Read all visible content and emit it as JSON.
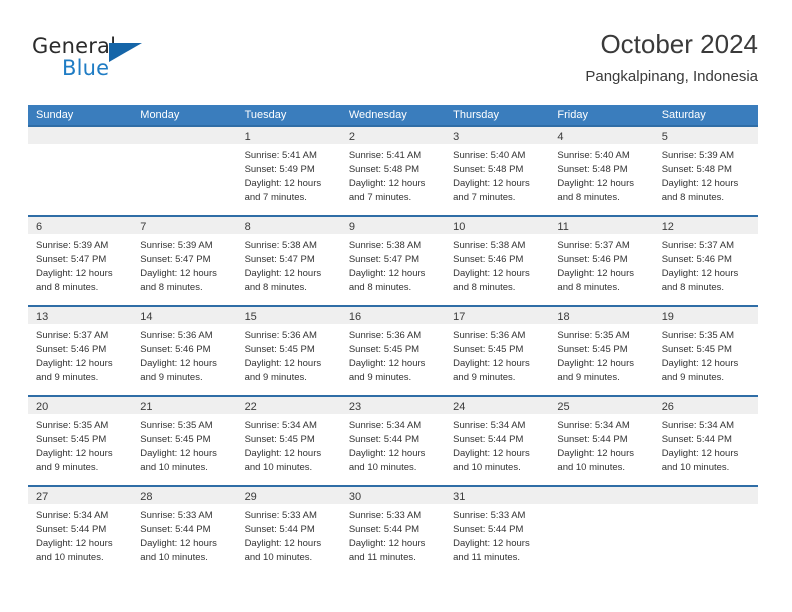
{
  "brand": {
    "name_top": "General",
    "name_bottom": "Blue",
    "triangle_icon": "triangle-icon",
    "color_dark": "#2b2b2b",
    "color_blue": "#1f7cc4"
  },
  "header": {
    "title": "October 2024",
    "subtitle": "Pangkalpinang, Indonesia"
  },
  "theme": {
    "header_bar": "#3a7dbd",
    "cell_top_border": "#2f6da6",
    "daynum_bg": "#efefef"
  },
  "weekdays": [
    "Sunday",
    "Monday",
    "Tuesday",
    "Wednesday",
    "Thursday",
    "Friday",
    "Saturday"
  ],
  "weeks": [
    [
      {
        "day": "",
        "sunrise": "",
        "sunset": "",
        "daylight_1": "",
        "daylight_2": ""
      },
      {
        "day": "",
        "sunrise": "",
        "sunset": "",
        "daylight_1": "",
        "daylight_2": ""
      },
      {
        "day": "1",
        "sunrise": "Sunrise: 5:41 AM",
        "sunset": "Sunset: 5:49 PM",
        "daylight_1": "Daylight: 12 hours",
        "daylight_2": "and 7 minutes."
      },
      {
        "day": "2",
        "sunrise": "Sunrise: 5:41 AM",
        "sunset": "Sunset: 5:48 PM",
        "daylight_1": "Daylight: 12 hours",
        "daylight_2": "and 7 minutes."
      },
      {
        "day": "3",
        "sunrise": "Sunrise: 5:40 AM",
        "sunset": "Sunset: 5:48 PM",
        "daylight_1": "Daylight: 12 hours",
        "daylight_2": "and 7 minutes."
      },
      {
        "day": "4",
        "sunrise": "Sunrise: 5:40 AM",
        "sunset": "Sunset: 5:48 PM",
        "daylight_1": "Daylight: 12 hours",
        "daylight_2": "and 8 minutes."
      },
      {
        "day": "5",
        "sunrise": "Sunrise: 5:39 AM",
        "sunset": "Sunset: 5:48 PM",
        "daylight_1": "Daylight: 12 hours",
        "daylight_2": "and 8 minutes."
      }
    ],
    [
      {
        "day": "6",
        "sunrise": "Sunrise: 5:39 AM",
        "sunset": "Sunset: 5:47 PM",
        "daylight_1": "Daylight: 12 hours",
        "daylight_2": "and 8 minutes."
      },
      {
        "day": "7",
        "sunrise": "Sunrise: 5:39 AM",
        "sunset": "Sunset: 5:47 PM",
        "daylight_1": "Daylight: 12 hours",
        "daylight_2": "and 8 minutes."
      },
      {
        "day": "8",
        "sunrise": "Sunrise: 5:38 AM",
        "sunset": "Sunset: 5:47 PM",
        "daylight_1": "Daylight: 12 hours",
        "daylight_2": "and 8 minutes."
      },
      {
        "day": "9",
        "sunrise": "Sunrise: 5:38 AM",
        "sunset": "Sunset: 5:47 PM",
        "daylight_1": "Daylight: 12 hours",
        "daylight_2": "and 8 minutes."
      },
      {
        "day": "10",
        "sunrise": "Sunrise: 5:38 AM",
        "sunset": "Sunset: 5:46 PM",
        "daylight_1": "Daylight: 12 hours",
        "daylight_2": "and 8 minutes."
      },
      {
        "day": "11",
        "sunrise": "Sunrise: 5:37 AM",
        "sunset": "Sunset: 5:46 PM",
        "daylight_1": "Daylight: 12 hours",
        "daylight_2": "and 8 minutes."
      },
      {
        "day": "12",
        "sunrise": "Sunrise: 5:37 AM",
        "sunset": "Sunset: 5:46 PM",
        "daylight_1": "Daylight: 12 hours",
        "daylight_2": "and 8 minutes."
      }
    ],
    [
      {
        "day": "13",
        "sunrise": "Sunrise: 5:37 AM",
        "sunset": "Sunset: 5:46 PM",
        "daylight_1": "Daylight: 12 hours",
        "daylight_2": "and 9 minutes."
      },
      {
        "day": "14",
        "sunrise": "Sunrise: 5:36 AM",
        "sunset": "Sunset: 5:46 PM",
        "daylight_1": "Daylight: 12 hours",
        "daylight_2": "and 9 minutes."
      },
      {
        "day": "15",
        "sunrise": "Sunrise: 5:36 AM",
        "sunset": "Sunset: 5:45 PM",
        "daylight_1": "Daylight: 12 hours",
        "daylight_2": "and 9 minutes."
      },
      {
        "day": "16",
        "sunrise": "Sunrise: 5:36 AM",
        "sunset": "Sunset: 5:45 PM",
        "daylight_1": "Daylight: 12 hours",
        "daylight_2": "and 9 minutes."
      },
      {
        "day": "17",
        "sunrise": "Sunrise: 5:36 AM",
        "sunset": "Sunset: 5:45 PM",
        "daylight_1": "Daylight: 12 hours",
        "daylight_2": "and 9 minutes."
      },
      {
        "day": "18",
        "sunrise": "Sunrise: 5:35 AM",
        "sunset": "Sunset: 5:45 PM",
        "daylight_1": "Daylight: 12 hours",
        "daylight_2": "and 9 minutes."
      },
      {
        "day": "19",
        "sunrise": "Sunrise: 5:35 AM",
        "sunset": "Sunset: 5:45 PM",
        "daylight_1": "Daylight: 12 hours",
        "daylight_2": "and 9 minutes."
      }
    ],
    [
      {
        "day": "20",
        "sunrise": "Sunrise: 5:35 AM",
        "sunset": "Sunset: 5:45 PM",
        "daylight_1": "Daylight: 12 hours",
        "daylight_2": "and 9 minutes."
      },
      {
        "day": "21",
        "sunrise": "Sunrise: 5:35 AM",
        "sunset": "Sunset: 5:45 PM",
        "daylight_1": "Daylight: 12 hours",
        "daylight_2": "and 10 minutes."
      },
      {
        "day": "22",
        "sunrise": "Sunrise: 5:34 AM",
        "sunset": "Sunset: 5:45 PM",
        "daylight_1": "Daylight: 12 hours",
        "daylight_2": "and 10 minutes."
      },
      {
        "day": "23",
        "sunrise": "Sunrise: 5:34 AM",
        "sunset": "Sunset: 5:44 PM",
        "daylight_1": "Daylight: 12 hours",
        "daylight_2": "and 10 minutes."
      },
      {
        "day": "24",
        "sunrise": "Sunrise: 5:34 AM",
        "sunset": "Sunset: 5:44 PM",
        "daylight_1": "Daylight: 12 hours",
        "daylight_2": "and 10 minutes."
      },
      {
        "day": "25",
        "sunrise": "Sunrise: 5:34 AM",
        "sunset": "Sunset: 5:44 PM",
        "daylight_1": "Daylight: 12 hours",
        "daylight_2": "and 10 minutes."
      },
      {
        "day": "26",
        "sunrise": "Sunrise: 5:34 AM",
        "sunset": "Sunset: 5:44 PM",
        "daylight_1": "Daylight: 12 hours",
        "daylight_2": "and 10 minutes."
      }
    ],
    [
      {
        "day": "27",
        "sunrise": "Sunrise: 5:34 AM",
        "sunset": "Sunset: 5:44 PM",
        "daylight_1": "Daylight: 12 hours",
        "daylight_2": "and 10 minutes."
      },
      {
        "day": "28",
        "sunrise": "Sunrise: 5:33 AM",
        "sunset": "Sunset: 5:44 PM",
        "daylight_1": "Daylight: 12 hours",
        "daylight_2": "and 10 minutes."
      },
      {
        "day": "29",
        "sunrise": "Sunrise: 5:33 AM",
        "sunset": "Sunset: 5:44 PM",
        "daylight_1": "Daylight: 12 hours",
        "daylight_2": "and 10 minutes."
      },
      {
        "day": "30",
        "sunrise": "Sunrise: 5:33 AM",
        "sunset": "Sunset: 5:44 PM",
        "daylight_1": "Daylight: 12 hours",
        "daylight_2": "and 11 minutes."
      },
      {
        "day": "31",
        "sunrise": "Sunrise: 5:33 AM",
        "sunset": "Sunset: 5:44 PM",
        "daylight_1": "Daylight: 12 hours",
        "daylight_2": "and 11 minutes."
      },
      {
        "day": "",
        "sunrise": "",
        "sunset": "",
        "daylight_1": "",
        "daylight_2": ""
      },
      {
        "day": "",
        "sunrise": "",
        "sunset": "",
        "daylight_1": "",
        "daylight_2": ""
      }
    ]
  ]
}
